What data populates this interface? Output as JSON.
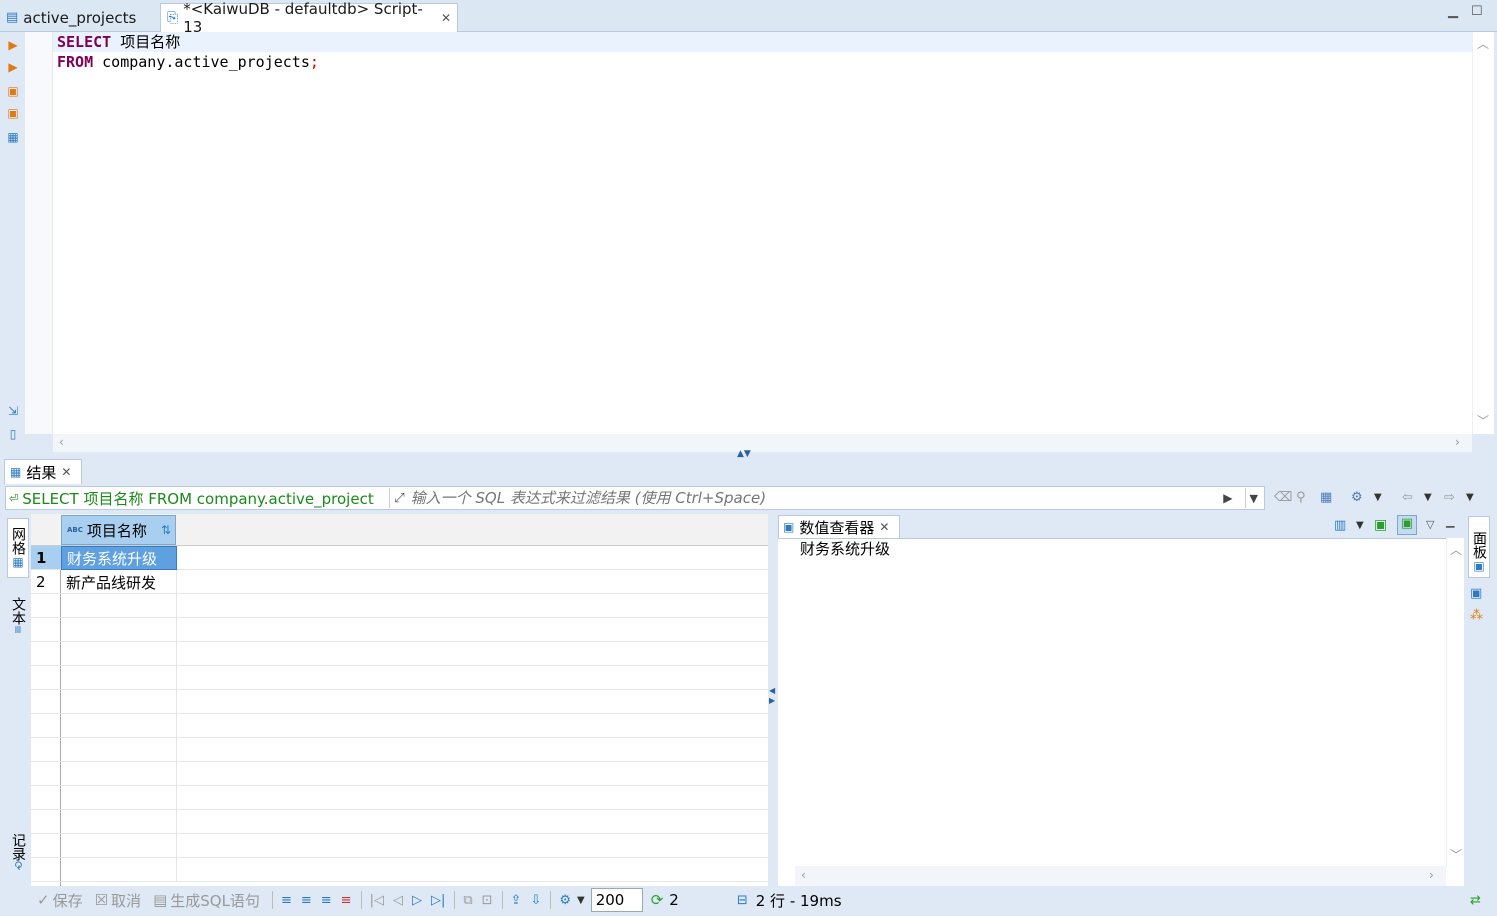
{
  "editor_tabs": [
    {
      "label": "active_projects",
      "icon": "table-view-icon"
    },
    {
      "label": "*<KaiwuDB - defaultdb> Script-13",
      "icon": "sql-script-icon"
    }
  ],
  "editor": {
    "line1_kw": "SELECT",
    "line1_rest": " 项目名称",
    "line2_kw": "FROM",
    "line2_rest": " company.active_projects",
    "line2_semi": ";"
  },
  "results": {
    "tab_label": "结果",
    "query_text": "SELECT 项目名称 FROM company.active_project",
    "filter_placeholder": "输入一个 SQL 表达式来过滤结果 (使用 Ctrl+Space)",
    "side_tabs": {
      "grid": "网格",
      "text": "文本",
      "record": "记录"
    },
    "column_header": "项目名称",
    "column_type_badge": "ABC",
    "rows": [
      {
        "num": "1",
        "value": "财务系统升级"
      },
      {
        "num": "2",
        "value": "新产品线研发"
      }
    ]
  },
  "value_viewer": {
    "tab_label": "数值查看器",
    "content": "财务系统升级",
    "panel_tab": "面板"
  },
  "bottom_toolbar": {
    "save": "保存",
    "cancel": "取消",
    "gen_sql": "生成SQL语句",
    "limit": "200",
    "refresh_count": "2",
    "status": "2 行 - 19ms"
  }
}
